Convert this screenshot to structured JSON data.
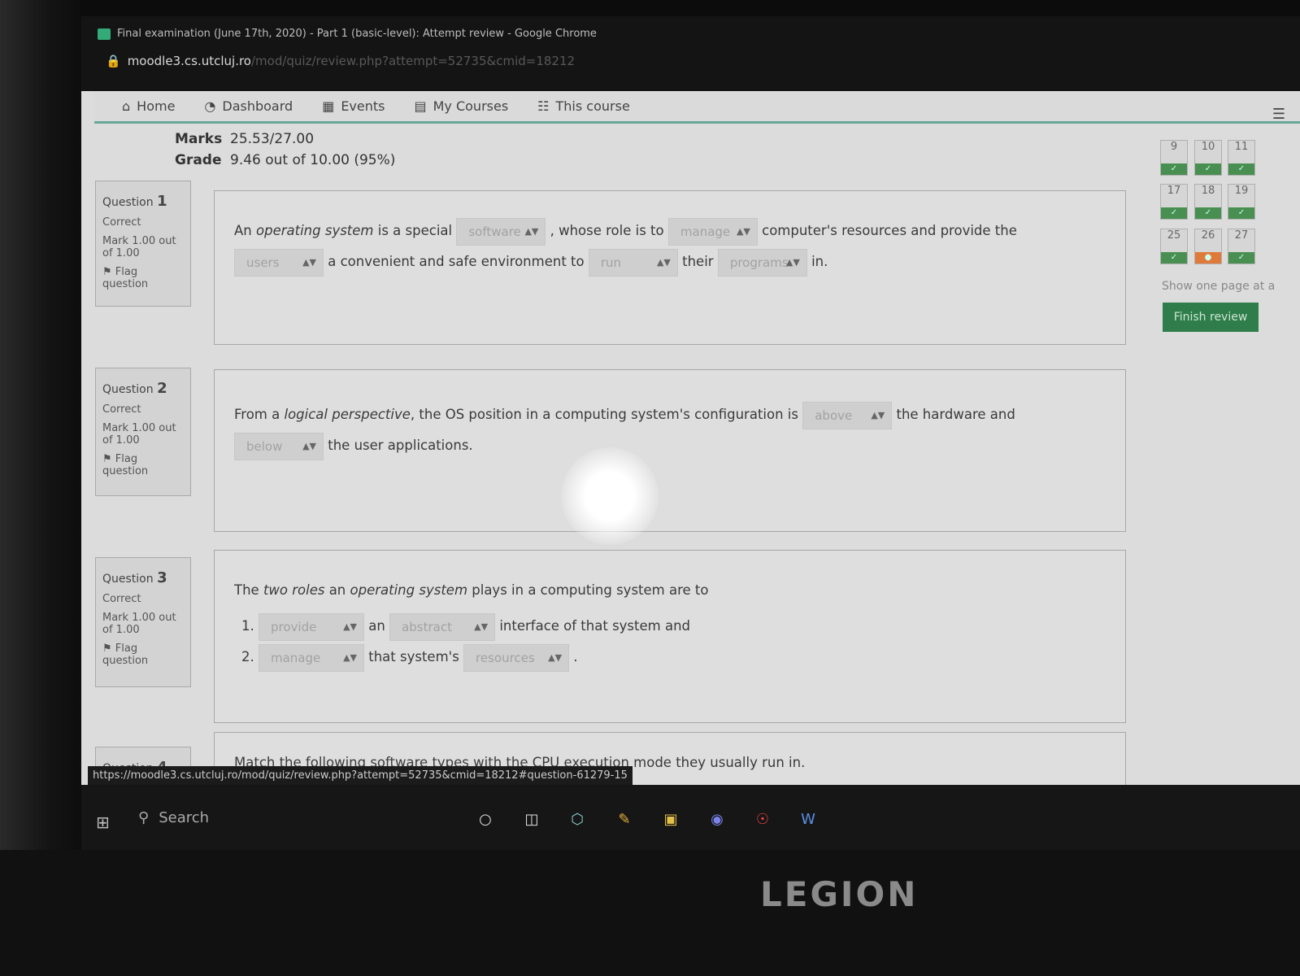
{
  "window": {
    "title": "Final examination (June 17th, 2020) - Part 1 (basic-level): Attempt review - Google Chrome",
    "url_host": "moodle3.cs.utcluj.ro",
    "url_path": "/mod/quiz/review.php?attempt=52735&cmid=18212"
  },
  "nav": {
    "items": [
      {
        "icon": "home-icon",
        "label": "Home"
      },
      {
        "icon": "dashboard-icon",
        "label": "Dashboard"
      },
      {
        "icon": "calendar-icon",
        "label": "Events"
      },
      {
        "icon": "briefcase-icon",
        "label": "My Courses"
      },
      {
        "icon": "sitemap-icon",
        "label": "This course"
      }
    ]
  },
  "summary": {
    "marks_label": "Marks",
    "marks_value": "25.53/27.00",
    "grade_label": "Grade",
    "grade_value": "9.46 out of 10.00 (95%)"
  },
  "questions": [
    {
      "num_label": "Question",
      "num": "1",
      "state": "Correct",
      "mark": "Mark 1.00 out of 1.00",
      "flag": "Flag question",
      "parts": {
        "t1": "An ",
        "t1i": "operating system",
        "t2": " is a special",
        "s1": "software",
        "t3": ", whose role is to",
        "s2": "manage",
        "t4": "computer's resources and provide the",
        "s3": "users",
        "t5": "a convenient and safe environment to",
        "s4": "run",
        "t6": "their",
        "s5": "programs",
        "t7": "in."
      }
    },
    {
      "num_label": "Question",
      "num": "2",
      "state": "Correct",
      "mark": "Mark 1.00 out of 1.00",
      "flag": "Flag question",
      "parts": {
        "t1": "From a ",
        "t1i": "logical perspective",
        "t2": ", the OS position in a computing system's configuration is",
        "s1": "above",
        "t3": "the hardware and",
        "s2": "below",
        "t4": "the user applications."
      }
    },
    {
      "num_label": "Question",
      "num": "3",
      "state": "Correct",
      "mark": "Mark 1.00 out of 1.00",
      "flag": "Flag question",
      "parts": {
        "t1": "The ",
        "t1i": "two roles",
        "t1b": " an ",
        "t1j": "operating system",
        "t2": " plays in a computing system are to",
        "l1_s1": "provide",
        "l1_t1": "an",
        "l1_s2": "abstract",
        "l1_t2": "interface of that system and",
        "l2_s1": "manage",
        "l2_t1": "that system's",
        "l2_s2": "resources",
        "l2_t2": "."
      }
    },
    {
      "num_label": "Question",
      "num": "4",
      "text": "Match the following software types with the CPU execution mode they usually run in."
    }
  ],
  "quiz_nav": {
    "buttons": [
      {
        "n": "9",
        "state": "correct"
      },
      {
        "n": "10",
        "state": "correct"
      },
      {
        "n": "11",
        "state": "correct"
      },
      {
        "n": "17",
        "state": "correct"
      },
      {
        "n": "18",
        "state": "correct"
      },
      {
        "n": "19",
        "state": "correct"
      },
      {
        "n": "25",
        "state": "correct"
      },
      {
        "n": "26",
        "state": "partial"
      },
      {
        "n": "27",
        "state": "correct"
      }
    ],
    "show_one_page": "Show one page at a",
    "finish_review": "Finish review"
  },
  "status_url": "https://moodle3.cs.utcluj.ro/mod/quiz/review.php?attempt=52735&cmid=18212#question-61279-15",
  "taskbar": {
    "search_label": "Search",
    "apps": [
      "cortana-icon",
      "task-view-icon",
      "3d-box-icon",
      "paint-icon",
      "file-explorer-icon",
      "teams-icon",
      "chrome-icon",
      "word-icon"
    ]
  },
  "brand": "LEGION"
}
